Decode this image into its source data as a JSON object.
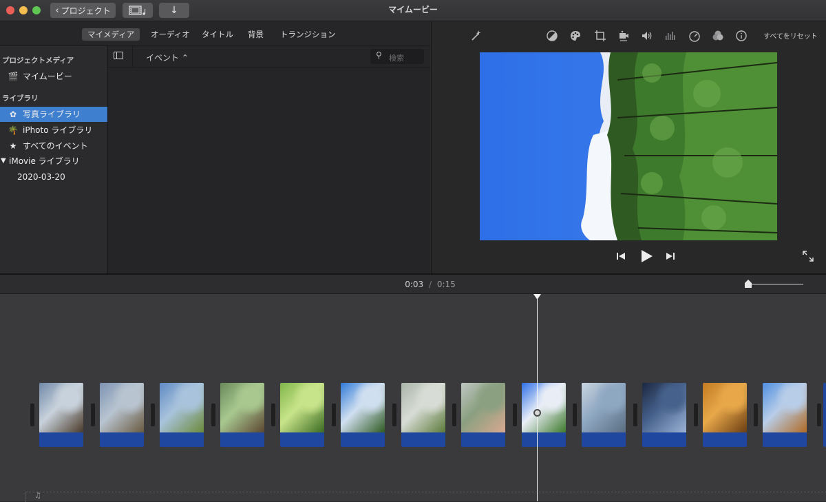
{
  "window": {
    "title": "マイムービー",
    "back_button": "プロジェクト",
    "traffic_lights": {
      "close": "#ec5f58",
      "minimize": "#f4bd4f",
      "zoom": "#5fc553"
    }
  },
  "browser": {
    "tabs": [
      {
        "label": "マイメディア",
        "active": true
      },
      {
        "label": "オーディオ",
        "active": false
      },
      {
        "label": "タイトル",
        "active": false
      },
      {
        "label": "背景",
        "active": false
      },
      {
        "label": "トランジション",
        "active": false
      }
    ],
    "events_label": "イベント ⌃",
    "search_placeholder": "検索"
  },
  "sidebar": {
    "project_media_header": "プロジェクトメディア",
    "project_item": "マイムービー",
    "library_header": "ライブラリ",
    "items": [
      {
        "label": "写真ライブラリ",
        "icon": "photos-icon",
        "selected": true
      },
      {
        "label": "iPhoto ライブラリ",
        "icon": "iphoto-icon",
        "selected": false
      },
      {
        "label": "すべてのイベント",
        "icon": "star-icon",
        "selected": false
      }
    ],
    "imovie_library": "iMovie ライブラリ",
    "event_date": "2020-03-20"
  },
  "viewer": {
    "reset_all": "すべてをリセット"
  },
  "timeline": {
    "current_time": "0:03",
    "separator": "/",
    "total_time": "0:15",
    "zoom_level": 0.0,
    "playhead_position": 0.2
  },
  "colors": {
    "accent": "#3f7fd0",
    "clip_strip": "#1f47a0"
  }
}
